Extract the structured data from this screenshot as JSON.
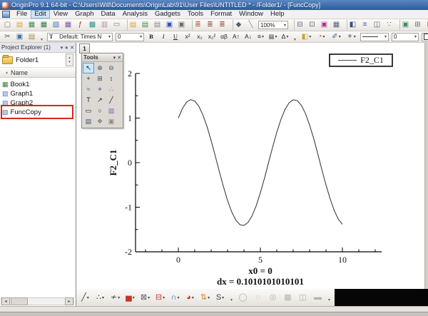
{
  "window": {
    "title": "OriginPro 9.1 64-bit - C:\\Users\\Will\\Documents\\OriginLab\\91\\User Files\\UNTITLED * - /Folder1/ - [FuncCopy]"
  },
  "ui": {
    "dd": "▾",
    "up": "▴",
    "left": "◂",
    "right": "▸",
    "close": "✕",
    "pin": "∗",
    "sort": "▴",
    "overflow": "»"
  },
  "menu": {
    "items": [
      {
        "label": "File"
      },
      {
        "label": "Edit",
        "hl": true
      },
      {
        "label": "View"
      },
      {
        "label": "Graph"
      },
      {
        "label": "Data"
      },
      {
        "label": "Analysis"
      },
      {
        "label": "Gadgets"
      },
      {
        "label": "Tools"
      },
      {
        "label": "Format"
      },
      {
        "label": "Window"
      },
      {
        "label": "Help"
      }
    ]
  },
  "toolbar_top": {
    "zoom_value": "100%",
    "icons_a": [
      {
        "name": "new-project",
        "glyph": "▢",
        "color": "#7d7a76"
      },
      {
        "name": "open",
        "glyph": "▤",
        "color": "#d9a62e"
      },
      {
        "name": "new-workbook",
        "glyph": "▦",
        "color": "#3f8f4a"
      },
      {
        "name": "new-excel",
        "glyph": "▦",
        "color": "#2e7d46"
      },
      {
        "name": "new-graph",
        "glyph": "▧",
        "color": "#4a6fc0"
      },
      {
        "name": "new-matrix",
        "glyph": "▦",
        "color": "#7a58b5"
      },
      {
        "name": "new-function-plot",
        "glyph": "ƒ",
        "color": "#b03a2e"
      },
      {
        "name": "new-3d-graph",
        "glyph": "▩",
        "color": "#2e8f8f"
      },
      {
        "name": "new-notes",
        "glyph": "▥",
        "color": "#b08da0"
      },
      {
        "name": "new-layout",
        "glyph": "▭",
        "color": "#7d7a76"
      },
      {
        "name": "open-template",
        "glyph": "▤",
        "color": "#d9a62e",
        "sep": true
      },
      {
        "name": "open-excel",
        "glyph": "▤",
        "color": "#3f8f4a"
      },
      {
        "name": "open-sample",
        "glyph": "▤",
        "color": "#8a8782"
      },
      {
        "name": "save-project",
        "glyph": "▣",
        "color": "#2f55b0"
      },
      {
        "name": "save-template",
        "glyph": "▣",
        "color": "#6f6c68"
      },
      {
        "name": "import-wizard",
        "glyph": "≣",
        "color": "#b05a3a",
        "sep": true
      },
      {
        "name": "import-ascii",
        "glyph": "≣",
        "color": "#9a4a3a"
      },
      {
        "name": "import-multiple-ascii",
        "glyph": "≣",
        "color": "#9a4a3a"
      },
      {
        "name": "recalculate",
        "glyph": "◆",
        "color": "#56636f",
        "sep": true
      },
      {
        "name": "digitize-image",
        "glyph": "╲",
        "color": "#8a8782"
      }
    ],
    "icons_b": [
      {
        "name": "print",
        "glyph": "⊟",
        "color": "#56636f",
        "sep": true
      },
      {
        "name": "presentation",
        "glyph": "⊡",
        "color": "#56636f"
      },
      {
        "name": "video-capture",
        "glyph": "▣",
        "color": "#b0348e"
      },
      {
        "name": "film-strip",
        "glyph": "▦",
        "color": "#56636f"
      },
      {
        "name": "new-folder",
        "glyph": "◧",
        "color": "#2f4f7f",
        "sep": true
      },
      {
        "name": "duplicate-window",
        "glyph": "≡",
        "color": "#2f5fb0"
      },
      {
        "name": "split-window",
        "glyph": "◫",
        "color": "#56636f"
      },
      {
        "name": "project-explorer-toggle",
        "glyph": "∵",
        "color": "#2f4f7f"
      },
      {
        "name": "view-image-mode",
        "glyph": "▣",
        "color": "#3a8a5f",
        "sel": true,
        "sep": true
      },
      {
        "name": "view-table-mode",
        "glyph": "⊞",
        "color": "#6f6c68"
      },
      {
        "name": "view-code-mode",
        "glyph": "⊞",
        "color": "#8f6f4f"
      },
      {
        "name": "customize-toolbar",
        "glyph": "✚",
        "color": "#7d7a76"
      },
      {
        "name": "add-object",
        "glyph": "+▏",
        "color": "#56636f"
      },
      {
        "name": "sum-sigma",
        "glyph": "Σ",
        "color": "#3f3c38",
        "sep": true
      }
    ]
  },
  "toolbar_format": {
    "clipboard": [
      {
        "name": "cut",
        "glyph": "✂",
        "color": "#5a5a5a"
      },
      {
        "name": "copy",
        "glyph": "▣",
        "color": "#4a6fa5"
      },
      {
        "name": "paste",
        "glyph": "▤",
        "color": "#b08a4a"
      }
    ],
    "font_prefix": "T",
    "font_value": "Default: Times N",
    "size_value": "0",
    "buttons": [
      {
        "name": "bold",
        "glyph": "B",
        "st": "b",
        "color": "#1c1c1c"
      },
      {
        "name": "italic",
        "glyph": "I",
        "st": "i",
        "color": "#1c1c1c"
      },
      {
        "name": "underline",
        "glyph": "U",
        "st": "u",
        "color": "#1c1c1c"
      },
      {
        "name": "superscript",
        "glyph": "x²",
        "color": "#1c1c1c"
      },
      {
        "name": "subscript",
        "glyph": "x₂",
        "color": "#1c1c1c"
      },
      {
        "name": "sub-superscript",
        "glyph": "x₂²",
        "color": "#1c1c1c"
      },
      {
        "name": "greek",
        "glyph": "αβ",
        "color": "#1c1c1c"
      },
      {
        "name": "increase-font",
        "glyph": "A↑",
        "color": "#1c1c1c"
      },
      {
        "name": "decrease-font",
        "glyph": "A↓",
        "color": "#1c1c1c"
      },
      {
        "name": "align",
        "glyph": "≡",
        "color": "#1c1c1c",
        "dd": "▾"
      },
      {
        "name": "table-format",
        "glyph": "▦",
        "color": "#56636f",
        "dd": "▾"
      },
      {
        "name": "symbol-map",
        "glyph": "Δ",
        "color": "#1c1c1c",
        "dd": "▾"
      }
    ],
    "style_icons": [
      {
        "name": "fill-color",
        "glyph": "◧",
        "color": "#c9a227",
        "dd": "▾"
      },
      {
        "name": "palette-color",
        "glyph": "◔",
        "color": "#b5652e",
        "dd": "▾"
      },
      {
        "name": "line-border-color",
        "glyph": "✐",
        "color": "#56636f",
        "dd": "▾"
      },
      {
        "name": "pattern-color",
        "glyph": "✶",
        "color": "#7d7a76",
        "dd": "▾"
      }
    ],
    "width_value": "0",
    "trail_value": "0"
  },
  "project_explorer": {
    "title": "Project Explorer (1)",
    "folder_label": "Folder1",
    "column_header": "Name",
    "items": [
      {
        "label": "Book1",
        "glyph": "▦",
        "color": "#2e7d32"
      },
      {
        "label": "Graph1",
        "glyph": "▧",
        "color": "#4a6fc0"
      },
      {
        "label": "Graph2",
        "glyph": "▧",
        "color": "#4a6fc0"
      },
      {
        "label": "FuncCopy",
        "glyph": "▧",
        "color": "#4a6fc0",
        "boxed": true
      }
    ],
    "highlight_color": "#d6281a"
  },
  "tools_palette": {
    "title": "Tools",
    "buttons": [
      {
        "name": "pointer-tool",
        "glyph": "↖",
        "color": "#1c1c1c",
        "sel": true
      },
      {
        "name": "zoom-in-tool",
        "glyph": "⊕",
        "color": "#35506f"
      },
      {
        "name": "zoom-out-tool",
        "glyph": "⊖",
        "color": "#35506f"
      },
      {
        "name": "screen-reader-tool",
        "glyph": "+",
        "color": "#1c1c1c"
      },
      {
        "name": "data-reader-tool",
        "glyph": "⊞",
        "color": "#35506f"
      },
      {
        "name": "data-selector-tool",
        "glyph": "↕",
        "color": "#1c1c1c"
      },
      {
        "name": "selection-on-plot-tool",
        "glyph": "≈",
        "color": "#2a6db5"
      },
      {
        "name": "mask-tool",
        "glyph": "✶",
        "color": "#8a5fb0"
      },
      {
        "name": "cluster-tool",
        "glyph": "∴",
        "color": "#7d7a76"
      },
      {
        "name": "text-tool",
        "glyph": "T",
        "color": "#1c1c1c"
      },
      {
        "name": "arrow-tool",
        "glyph": "↗",
        "color": "#1c1c1c"
      },
      {
        "name": "line-tool",
        "glyph": "╱",
        "color": "#1c1c1c"
      },
      {
        "name": "rectangle-tool",
        "glyph": "▭",
        "color": "#1c1c1c"
      },
      {
        "name": "circle-tool",
        "glyph": "○",
        "color": "#1c1c1c"
      },
      {
        "name": "insert-image-tool",
        "glyph": "▨",
        "color": "#8a5fb0"
      },
      {
        "name": "insert-graph-tool",
        "glyph": "▤",
        "color": "#35506f"
      },
      {
        "name": "freehand-tool",
        "glyph": "❖",
        "color": "#7d7a76"
      },
      {
        "name": "3d-rotate-tool",
        "glyph": "▣",
        "color": "#8a8782"
      }
    ]
  },
  "graph": {
    "layer": "1",
    "legend_label": "F2_C1"
  },
  "chart_data": {
    "type": "line",
    "title": "",
    "xlabel_lines": [
      "x0 = 0",
      "dx = 0.1010101010101"
    ],
    "ylabel": "F2_C1",
    "xlim": [
      -2.6,
      12.4
    ],
    "ylim": [
      -2,
      2
    ],
    "xticks": [
      0,
      5,
      10
    ],
    "xminor": [
      -2,
      -1,
      1,
      2,
      3,
      4,
      6,
      7,
      8,
      9,
      11,
      12
    ],
    "yticks": [
      2,
      1,
      0,
      -1,
      -2
    ],
    "yminor": [
      1.5,
      0.5,
      -0.5,
      -1.5
    ],
    "grid": false,
    "legend": {
      "label": "F2_C1",
      "position": "top-right"
    },
    "series": [
      {
        "name": "F2_C1",
        "x": [
          0,
          0.25,
          0.5,
          0.75,
          1,
          1.25,
          1.5,
          1.75,
          2,
          2.25,
          2.5,
          2.75,
          3,
          3.25,
          3.5,
          3.75,
          4,
          4.25,
          4.5,
          4.75,
          5,
          5.25,
          5.5,
          5.75,
          6,
          6.25,
          6.5,
          6.75,
          7,
          7.25,
          7.5,
          7.75,
          8,
          8.25,
          8.5,
          8.75,
          9,
          9.25,
          9.5,
          9.75,
          10
        ],
        "y": [
          1.0,
          1.216,
          1.357,
          1.413,
          1.382,
          1.264,
          1.068,
          0.806,
          0.493,
          0.15,
          -0.203,
          -0.543,
          -0.849,
          -1.102,
          -1.287,
          -1.392,
          -1.41,
          -1.341,
          -1.188,
          -0.962,
          -0.675,
          -0.347,
          0.003,
          0.353,
          0.681,
          0.966,
          1.192,
          1.343,
          1.411,
          1.391,
          1.285,
          1.099,
          0.844,
          0.539,
          0.197,
          -0.163,
          -0.499,
          -0.811,
          -1.072,
          -1.267,
          -1.383
        ]
      }
    ],
    "line_color": "#3f3f3f"
  },
  "toolbar_2d": {
    "icons": [
      {
        "name": "line-plot",
        "glyph": "╱",
        "color": "#3f3c38",
        "dd": "▾"
      },
      {
        "name": "scatter-plot",
        "glyph": "∴",
        "color": "#3f3c38",
        "dd": "▾"
      },
      {
        "name": "line-symbol-plot",
        "glyph": "≁",
        "color": "#3f3c38",
        "dd": "▾"
      },
      {
        "name": "column-chart",
        "glyph": "▅",
        "color": "#c0392b",
        "dd": "▾"
      },
      {
        "name": "template-library",
        "glyph": "⊠",
        "color": "#56636f",
        "dd": "▾"
      },
      {
        "name": "box-chart",
        "glyph": "⊟",
        "color": "#c0392b",
        "dd": "▾"
      },
      {
        "name": "area-chart",
        "glyph": "∩",
        "color": "#2f5fb0",
        "dd": "▾"
      },
      {
        "name": "pie-chart",
        "glyph": "◕",
        "color": "#c0392b",
        "dd": "▾"
      },
      {
        "name": "vector-chart",
        "glyph": "⇅",
        "color": "#d9822e",
        "dd": "▾"
      },
      {
        "name": "stock-chart",
        "glyph": "S",
        "color": "#3f3c38",
        "dd": "▾"
      }
    ],
    "icons_disabled": [
      {
        "name": "layout-tool-disabled",
        "glyph": "◯",
        "color": "#b5b2ad"
      },
      {
        "name": "layout-tool-disabled",
        "glyph": "◌",
        "color": "#b5b2ad"
      },
      {
        "name": "layout-tool-disabled",
        "glyph": "◎",
        "color": "#b5b2ad"
      },
      {
        "name": "layout-tool-disabled",
        "glyph": "▦",
        "color": "#b5b2ad"
      },
      {
        "name": "layout-tool-disabled",
        "glyph": "◫",
        "color": "#b5b2ad"
      },
      {
        "name": "layout-tool-disabled",
        "glyph": "▬",
        "color": "#b5b2ad"
      }
    ]
  }
}
